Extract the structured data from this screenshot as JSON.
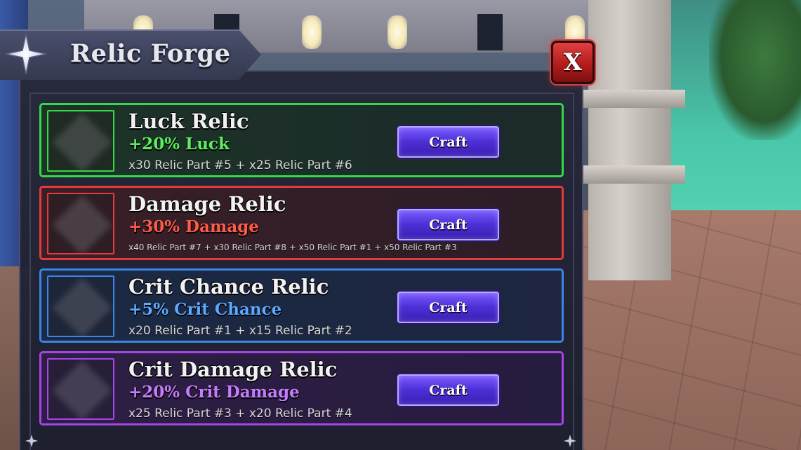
{
  "window": {
    "title": "Relic Forge",
    "close_label": "X"
  },
  "relics": [
    {
      "name": "Luck Relic",
      "bonus": "+20% Luck",
      "cost": "x30 Relic Part #5 + x25 Relic Part #6",
      "craft_label": "Craft",
      "color": "#35d84a"
    },
    {
      "name": "Damage Relic",
      "bonus": "+30% Damage",
      "cost": "x40 Relic Part #7 + x30 Relic Part #8 + x50 Relic Part #1 + x50 Relic Part #3",
      "craft_label": "Craft",
      "color": "#e33b3b"
    },
    {
      "name": "Crit Chance Relic",
      "bonus": "+5% Crit Chance",
      "cost": "x20 Relic Part #1 + x15 Relic Part #2",
      "craft_label": "Craft",
      "color": "#3a86e8"
    },
    {
      "name": "Crit Damage Relic",
      "bonus": "+20% Crit Damage",
      "cost": "x25 Relic Part #3 + x20 Relic Part #4",
      "craft_label": "Craft",
      "color": "#a545e8"
    }
  ],
  "icons": {
    "title": "sparkle-star-icon",
    "close": "close-icon"
  }
}
